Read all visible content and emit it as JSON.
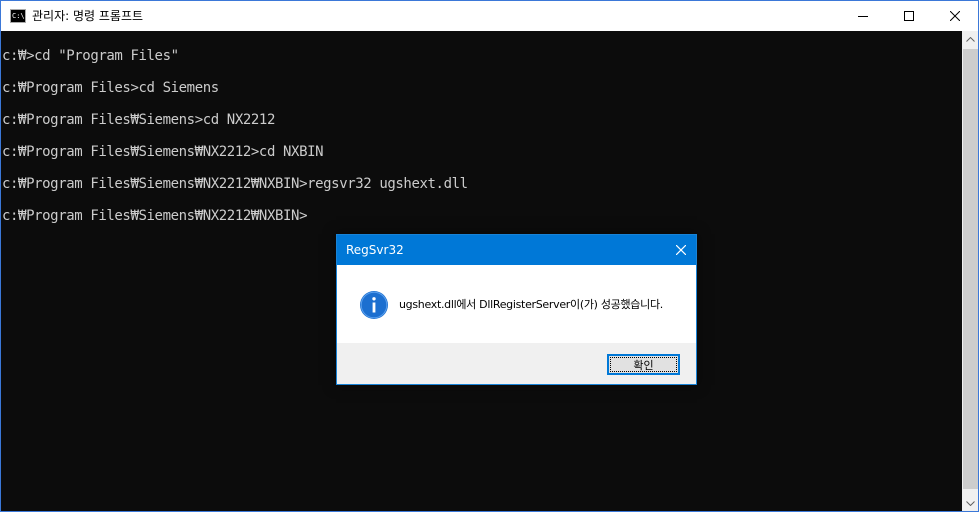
{
  "window": {
    "title": "관리자: 명령 프롬프트",
    "app_icon_text": "C:\\",
    "icons": {
      "app": "cmd-icon",
      "minimize": "minimize-icon",
      "maximize": "maximize-icon",
      "close": "close-icon"
    }
  },
  "console": {
    "lines": [
      "c:₩>cd \"Program Files\"",
      "c:₩Program Files>cd Siemens",
      "c:₩Program Files₩Siemens>cd NX2212",
      "c:₩Program Files₩Siemens₩NX2212>cd NXBIN",
      "c:₩Program Files₩Siemens₩NX2212₩NXBIN>regsvr32 ugshext.dll",
      "c:₩Program Files₩Siemens₩NX2212₩NXBIN>"
    ],
    "text_color": "#cccccc",
    "background": "#0c0c0c"
  },
  "dialog": {
    "title": "RegSvr32",
    "message": "ugshext.dll에서 DllRegisterServer이(가) 성공했습니다.",
    "ok_label": "확인",
    "accent": "#0078d7",
    "icon": "info-icon"
  },
  "scrollbar": {
    "icons": [
      "scroll-up-arrow-icon",
      "scroll-down-arrow-icon"
    ]
  }
}
